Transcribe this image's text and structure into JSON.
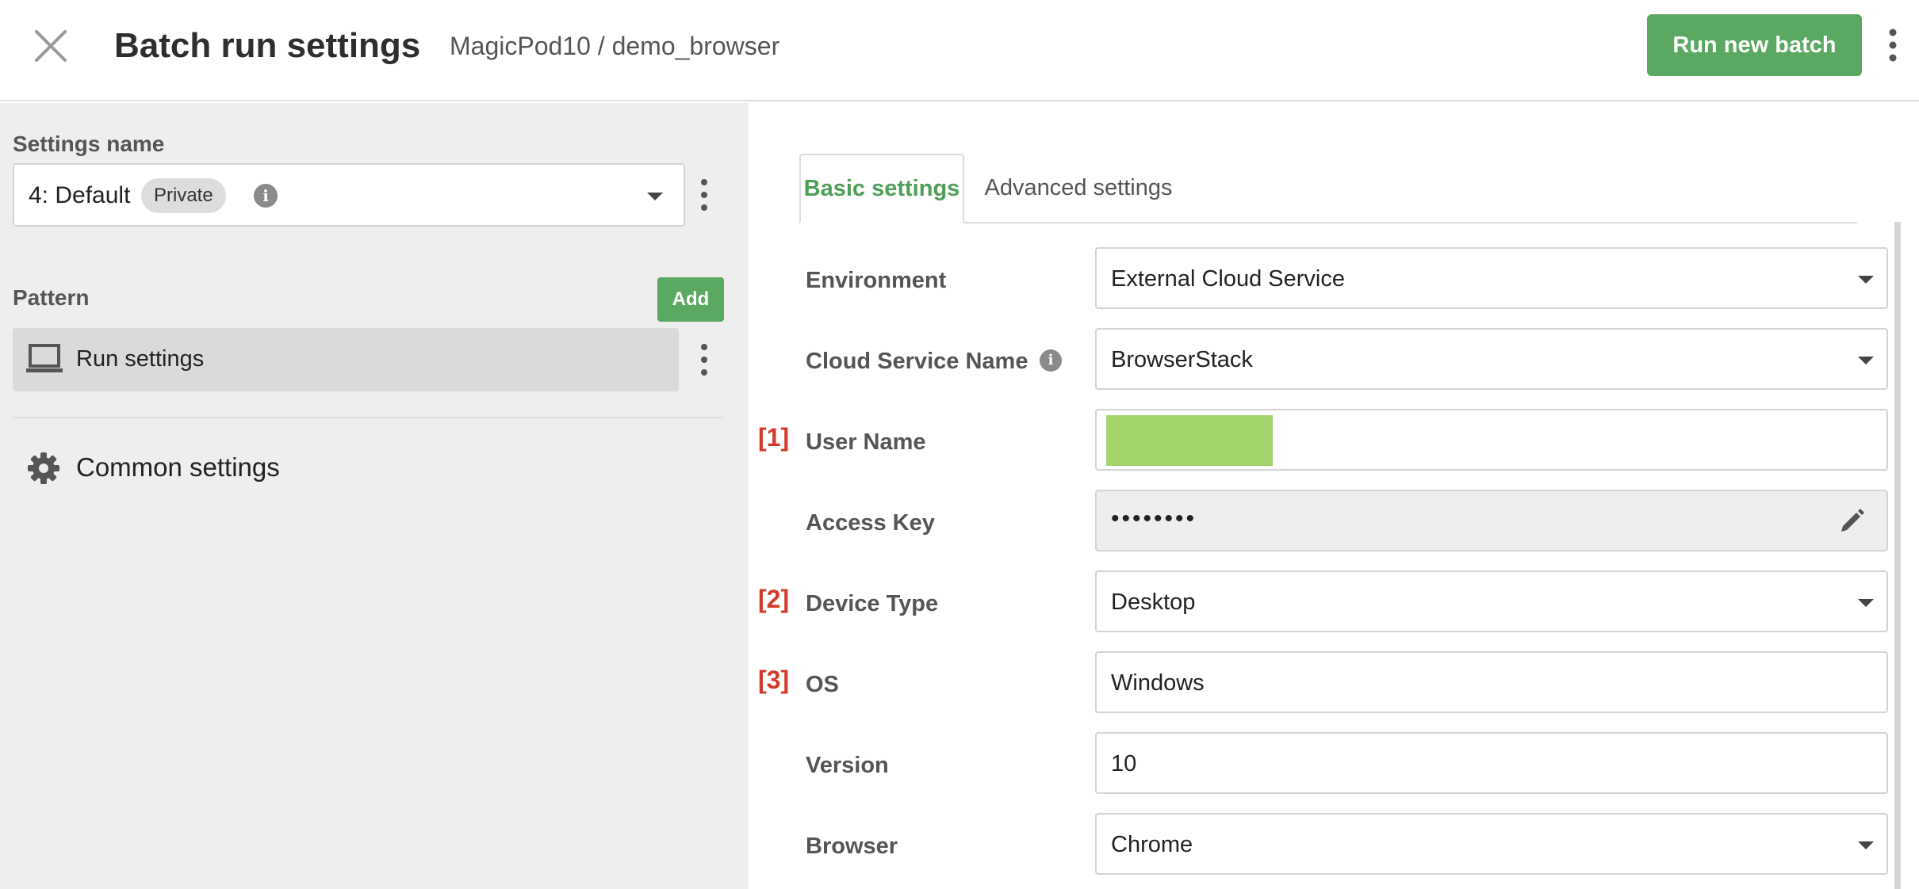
{
  "header": {
    "title": "Batch run settings",
    "breadcrumb": "MagicPod10 / demo_browser",
    "run_button": "Run new batch",
    "accent_color": "#5ba862"
  },
  "sidebar": {
    "settings_name_label": "Settings name",
    "settings_select": {
      "value": "4: Default",
      "badge": "Private"
    },
    "pattern_label": "Pattern",
    "add_button": "Add",
    "pattern_items": [
      {
        "label": "Run settings",
        "icon": "laptop-icon"
      }
    ],
    "common_settings": {
      "label": "Common settings",
      "icon": "gear-icon"
    }
  },
  "tabs": [
    {
      "label": "Basic settings",
      "active": true
    },
    {
      "label": "Advanced settings",
      "active": false
    }
  ],
  "form": {
    "environment": {
      "label": "Environment",
      "value": "External Cloud Service"
    },
    "cloud_service_name": {
      "label": "Cloud Service Name",
      "value": "BrowserStack"
    },
    "user_name": {
      "label": "User Name",
      "marker": "[1]",
      "value": ""
    },
    "access_key": {
      "label": "Access Key",
      "value": "••••••••"
    },
    "device_type": {
      "label": "Device Type",
      "marker": "[2]",
      "value": "Desktop"
    },
    "os": {
      "label": "OS",
      "marker": "[3]",
      "value": "Windows"
    },
    "version": {
      "label": "Version",
      "value": "10"
    },
    "browser": {
      "label": "Browser",
      "value": "Chrome"
    }
  },
  "colors": {
    "marker": "#d43a2a",
    "redaction": "#a3d46b",
    "active_tab": "#4f9e57"
  }
}
